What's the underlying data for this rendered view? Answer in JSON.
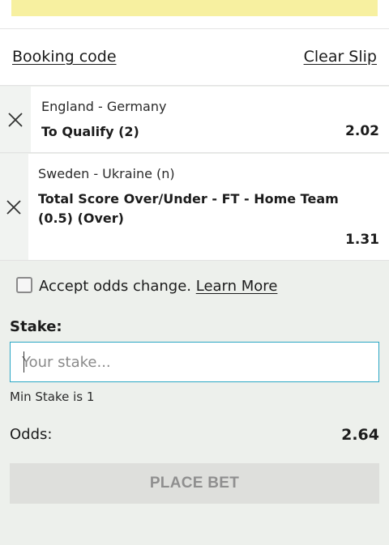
{
  "slip_links": {
    "booking_code": "Booking code",
    "clear_slip": "Clear Slip"
  },
  "bets": [
    {
      "event": "England - Germany",
      "market": "To Qualify (2)",
      "odds": "2.02"
    },
    {
      "event": "Sweden - Ukraine (n)",
      "market": "Total Score Over/Under - FT - Home Team (0.5) (Over)",
      "odds": "1.31"
    }
  ],
  "accept_odds": {
    "label": "Accept odds change.",
    "learn_more": "Learn More",
    "checked": false
  },
  "stake": {
    "label": "Stake:",
    "placeholder": "Your stake...",
    "value": "",
    "min_stake": "Min Stake is 1"
  },
  "totals": {
    "odds_label": "Odds:",
    "odds_value": "2.64"
  },
  "place_bet": {
    "label": "PLACE BET"
  },
  "colors": {
    "banner": "#f7f0a0",
    "input_border": "#2aa7c4",
    "panel_bg": "#edf0ec",
    "button_bg": "#dedfdc",
    "button_text": "#8f8f8f"
  },
  "icons": {
    "remove": "close-icon",
    "checkbox": "checkbox-icon"
  }
}
